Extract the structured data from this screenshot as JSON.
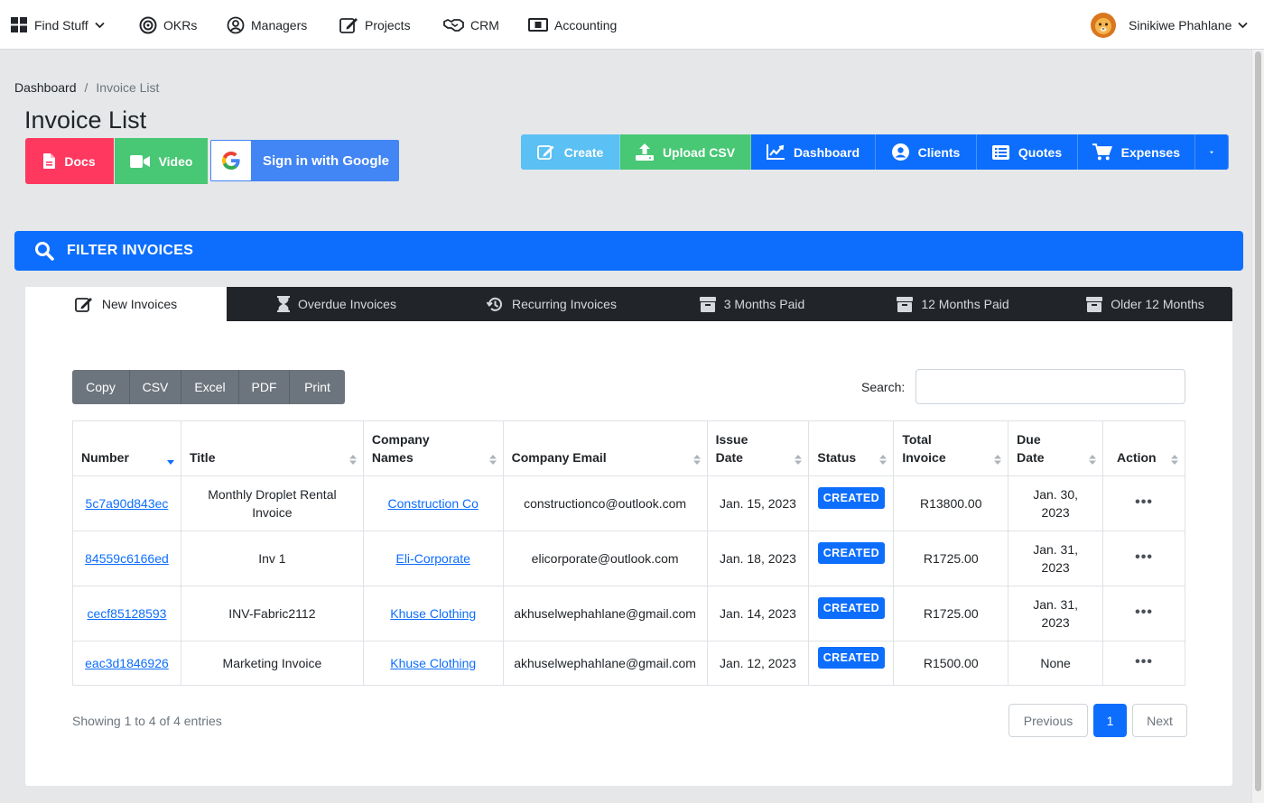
{
  "nav": {
    "find_stuff": "Find Stuff",
    "okrs": "OKRs",
    "managers": "Managers",
    "projects": "Projects",
    "crm": "CRM",
    "accounting": "Accounting",
    "user_name": "Sinikiwe Phahlane"
  },
  "breadcrumb": {
    "root": "Dashboard",
    "separator": "/",
    "current": "Invoice List"
  },
  "page_title": "Invoice List",
  "help_buttons": {
    "docs": "Docs",
    "video": "Video",
    "google_signin": "Sign in with Google"
  },
  "actions": {
    "create": "Create",
    "upload_csv": "Upload CSV",
    "dashboard": "Dashboard",
    "clients": "Clients",
    "quotes": "Quotes",
    "expenses": "Expenses"
  },
  "filter_bar": {
    "label": "FILTER INVOICES"
  },
  "tabs": [
    {
      "label": "New Invoices",
      "icon": "edit-icon"
    },
    {
      "label": "Overdue Invoices",
      "icon": "hourglass-icon"
    },
    {
      "label": "Recurring Invoices",
      "icon": "history-icon"
    },
    {
      "label": "3 Months Paid",
      "icon": "archive-icon"
    },
    {
      "label": "12 Months Paid",
      "icon": "archive-icon"
    },
    {
      "label": "Older 12 Months",
      "icon": "archive-icon"
    }
  ],
  "export_buttons": {
    "copy": "Copy",
    "csv": "CSV",
    "excel": "Excel",
    "pdf": "PDF",
    "print": "Print"
  },
  "search": {
    "label": "Search:",
    "value": "",
    "placeholder": ""
  },
  "table": {
    "headers": {
      "number": "Number",
      "title": "Title",
      "company_names": "Company Names",
      "company_email": "Company Email",
      "issue_date": "Issue Date",
      "status": "Status",
      "total_invoice": "Total Invoice",
      "due_date": "Due Date",
      "action": "Action"
    },
    "rows": [
      {
        "number": "5c7a90d843ec",
        "title": "Monthly Droplet Rental Invoice",
        "company": "Construction Co",
        "email": "constructionco@outlook.com",
        "issue_date": "Jan. 15, 2023",
        "status": "CREATED",
        "total": "R13800.00",
        "due_date": "Jan. 30, 2023",
        "action": "•••"
      },
      {
        "number": "84559c6166ed",
        "title": "Inv 1",
        "company": "Eli-Corporate",
        "email": "elicorporate@outlook.com",
        "issue_date": "Jan. 18, 2023",
        "status": "CREATED",
        "total": "R1725.00",
        "due_date": "Jan. 31, 2023",
        "action": "•••"
      },
      {
        "number": "cecf85128593",
        "title": "INV-Fabric2112",
        "company": "Khuse Clothing",
        "email": "akhuselwephahlane@gmail.com",
        "issue_date": "Jan. 14, 2023",
        "status": "CREATED",
        "total": "R1725.00",
        "due_date": "Jan. 31, 2023",
        "action": "•••"
      },
      {
        "number": "eac3d1846926",
        "title": "Marketing Invoice",
        "company": "Khuse Clothing",
        "email": "akhuselwephahlane@gmail.com",
        "issue_date": "Jan. 12, 2023",
        "status": "CREATED",
        "total": "R1500.00",
        "due_date": "None",
        "action": "•••"
      }
    ]
  },
  "footer": {
    "showing": "Showing 1 to 4 of 4 entries",
    "previous": "Previous",
    "current_page": "1",
    "next": "Next"
  },
  "colors": {
    "primary": "#0d6efd",
    "docs": "#ff3860",
    "video": "#48c774",
    "create": "#5bc0f3",
    "upload": "#48c774",
    "google": "#4285f4",
    "tab_bar": "#212529",
    "export": "#6c757d"
  }
}
